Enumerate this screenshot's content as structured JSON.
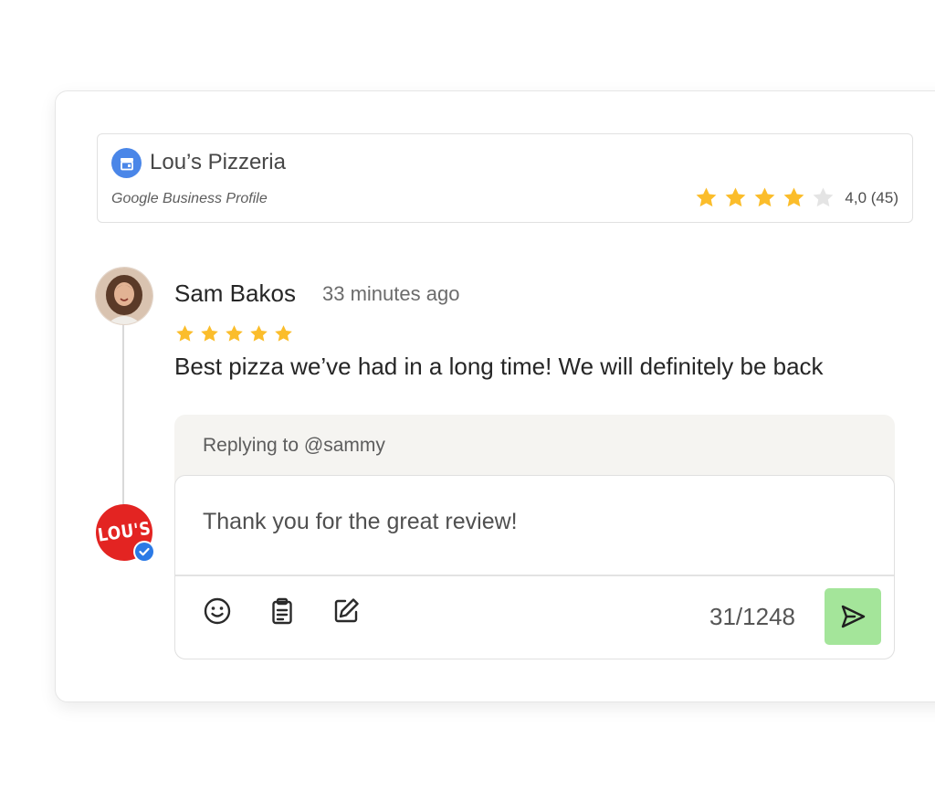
{
  "business": {
    "name": "Lou’s Pizzeria",
    "source": "Google Business Profile",
    "rating_value": 4,
    "rating_max": 5,
    "rating_text": "4,0 (45)",
    "icon": "storefront-icon"
  },
  "review": {
    "author": "Sam Bakos",
    "time_ago": "33 minutes ago",
    "stars": 5,
    "text": "Best pizza we’ve had in a long time! We will definitely be back"
  },
  "reply": {
    "replying_to": "Replying to @sammy",
    "logo_text": "LOU'S",
    "draft_text": "Thank you for the great review!",
    "char_count": "31/1248",
    "tools": [
      "emoji-icon",
      "clipboard-icon",
      "edit-icon"
    ],
    "send_icon": "send-icon"
  },
  "colors": {
    "star_filled": "#fbbd2b",
    "star_empty": "#e4e4e4",
    "send_button": "#a4e59a",
    "brand_red": "#e32422",
    "verified_blue": "#2b7ae6",
    "profile_icon_blue": "#4a86e8"
  }
}
